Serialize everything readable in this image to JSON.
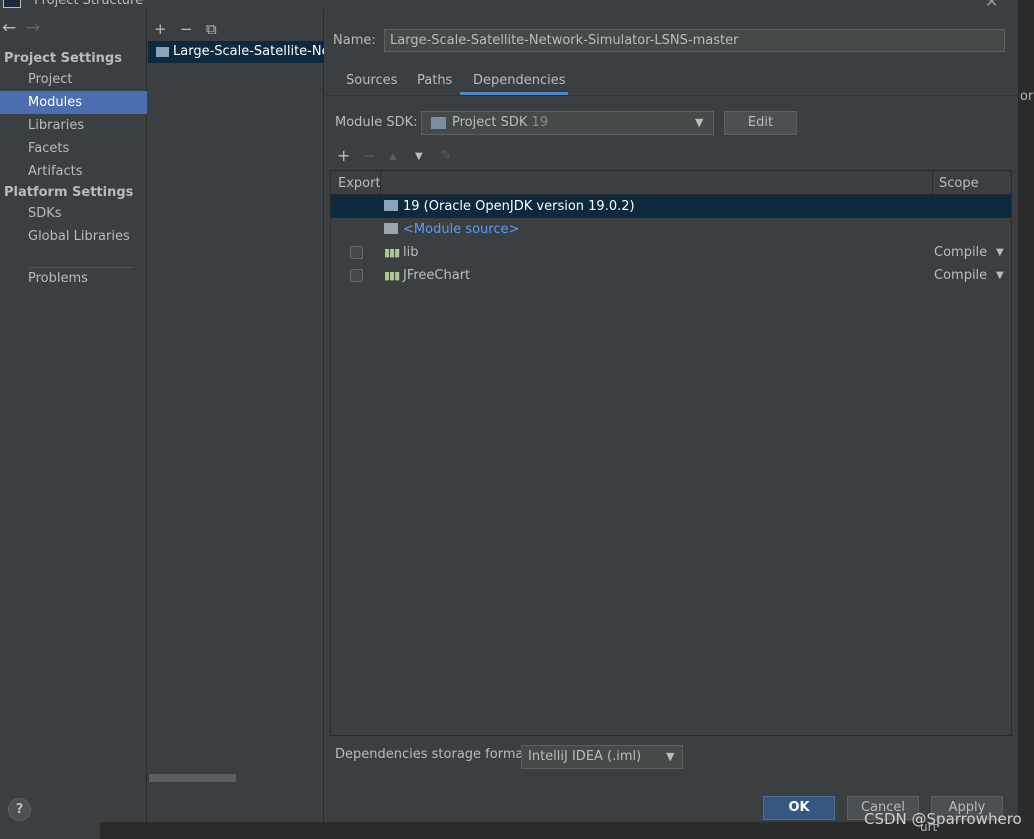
{
  "window": {
    "title": "Project Structure",
    "close_glyph": "✕"
  },
  "nav": {
    "back_glyph": "←",
    "forward_glyph": "→",
    "project_settings_heading": "Project Settings",
    "project_settings_items": [
      "Project",
      "Modules",
      "Libraries",
      "Facets",
      "Artifacts"
    ],
    "platform_settings_heading": "Platform Settings",
    "platform_settings_items": [
      "SDKs",
      "Global Libraries"
    ],
    "problems": "Problems",
    "selected": "Modules"
  },
  "modules_toolbar": {
    "add_glyph": "+",
    "remove_glyph": "−",
    "copy_glyph": "⧉"
  },
  "module": {
    "list_item": "Large-Scale-Satellite-Netw",
    "name_label": "Name:",
    "name_value": "Large-Scale-Satellite-Network-Simulator-LSNS-master"
  },
  "tabs": [
    "Sources",
    "Paths",
    "Dependencies"
  ],
  "active_tab": "Dependencies",
  "sdk": {
    "label": "Module SDK:",
    "value": "Project SDK",
    "version": "19",
    "edit_label": "Edit"
  },
  "deps_toolbar": {
    "add_glyph": "+",
    "remove_glyph": "−",
    "up_glyph": "▲",
    "down_glyph": "▼",
    "edit_glyph": "✎"
  },
  "table": {
    "col_export": "Export",
    "col_scope": "Scope",
    "rows": [
      {
        "name": "19 (Oracle OpenJDK version 19.0.2)",
        "scope": ""
      },
      {
        "name": "<Module source>",
        "scope": ""
      },
      {
        "name": "lib",
        "scope": "Compile"
      },
      {
        "name": "JFreeChart",
        "scope": "Compile"
      }
    ]
  },
  "storage": {
    "label": "Dependencies storage format:",
    "value": "IntelliJ IDEA (.iml)"
  },
  "buttons": {
    "help": "?",
    "ok": "OK",
    "cancel": "Cancel",
    "apply": "Apply"
  },
  "background": {
    "right_fragment": "ork",
    "bottom_fragment": "urt"
  },
  "watermark": "CSDN @Sparrowhero",
  "colors": {
    "selection": "#4b6eaf",
    "row_selection": "#0d293e",
    "link": "#589df6",
    "ok_button": "#365880"
  }
}
